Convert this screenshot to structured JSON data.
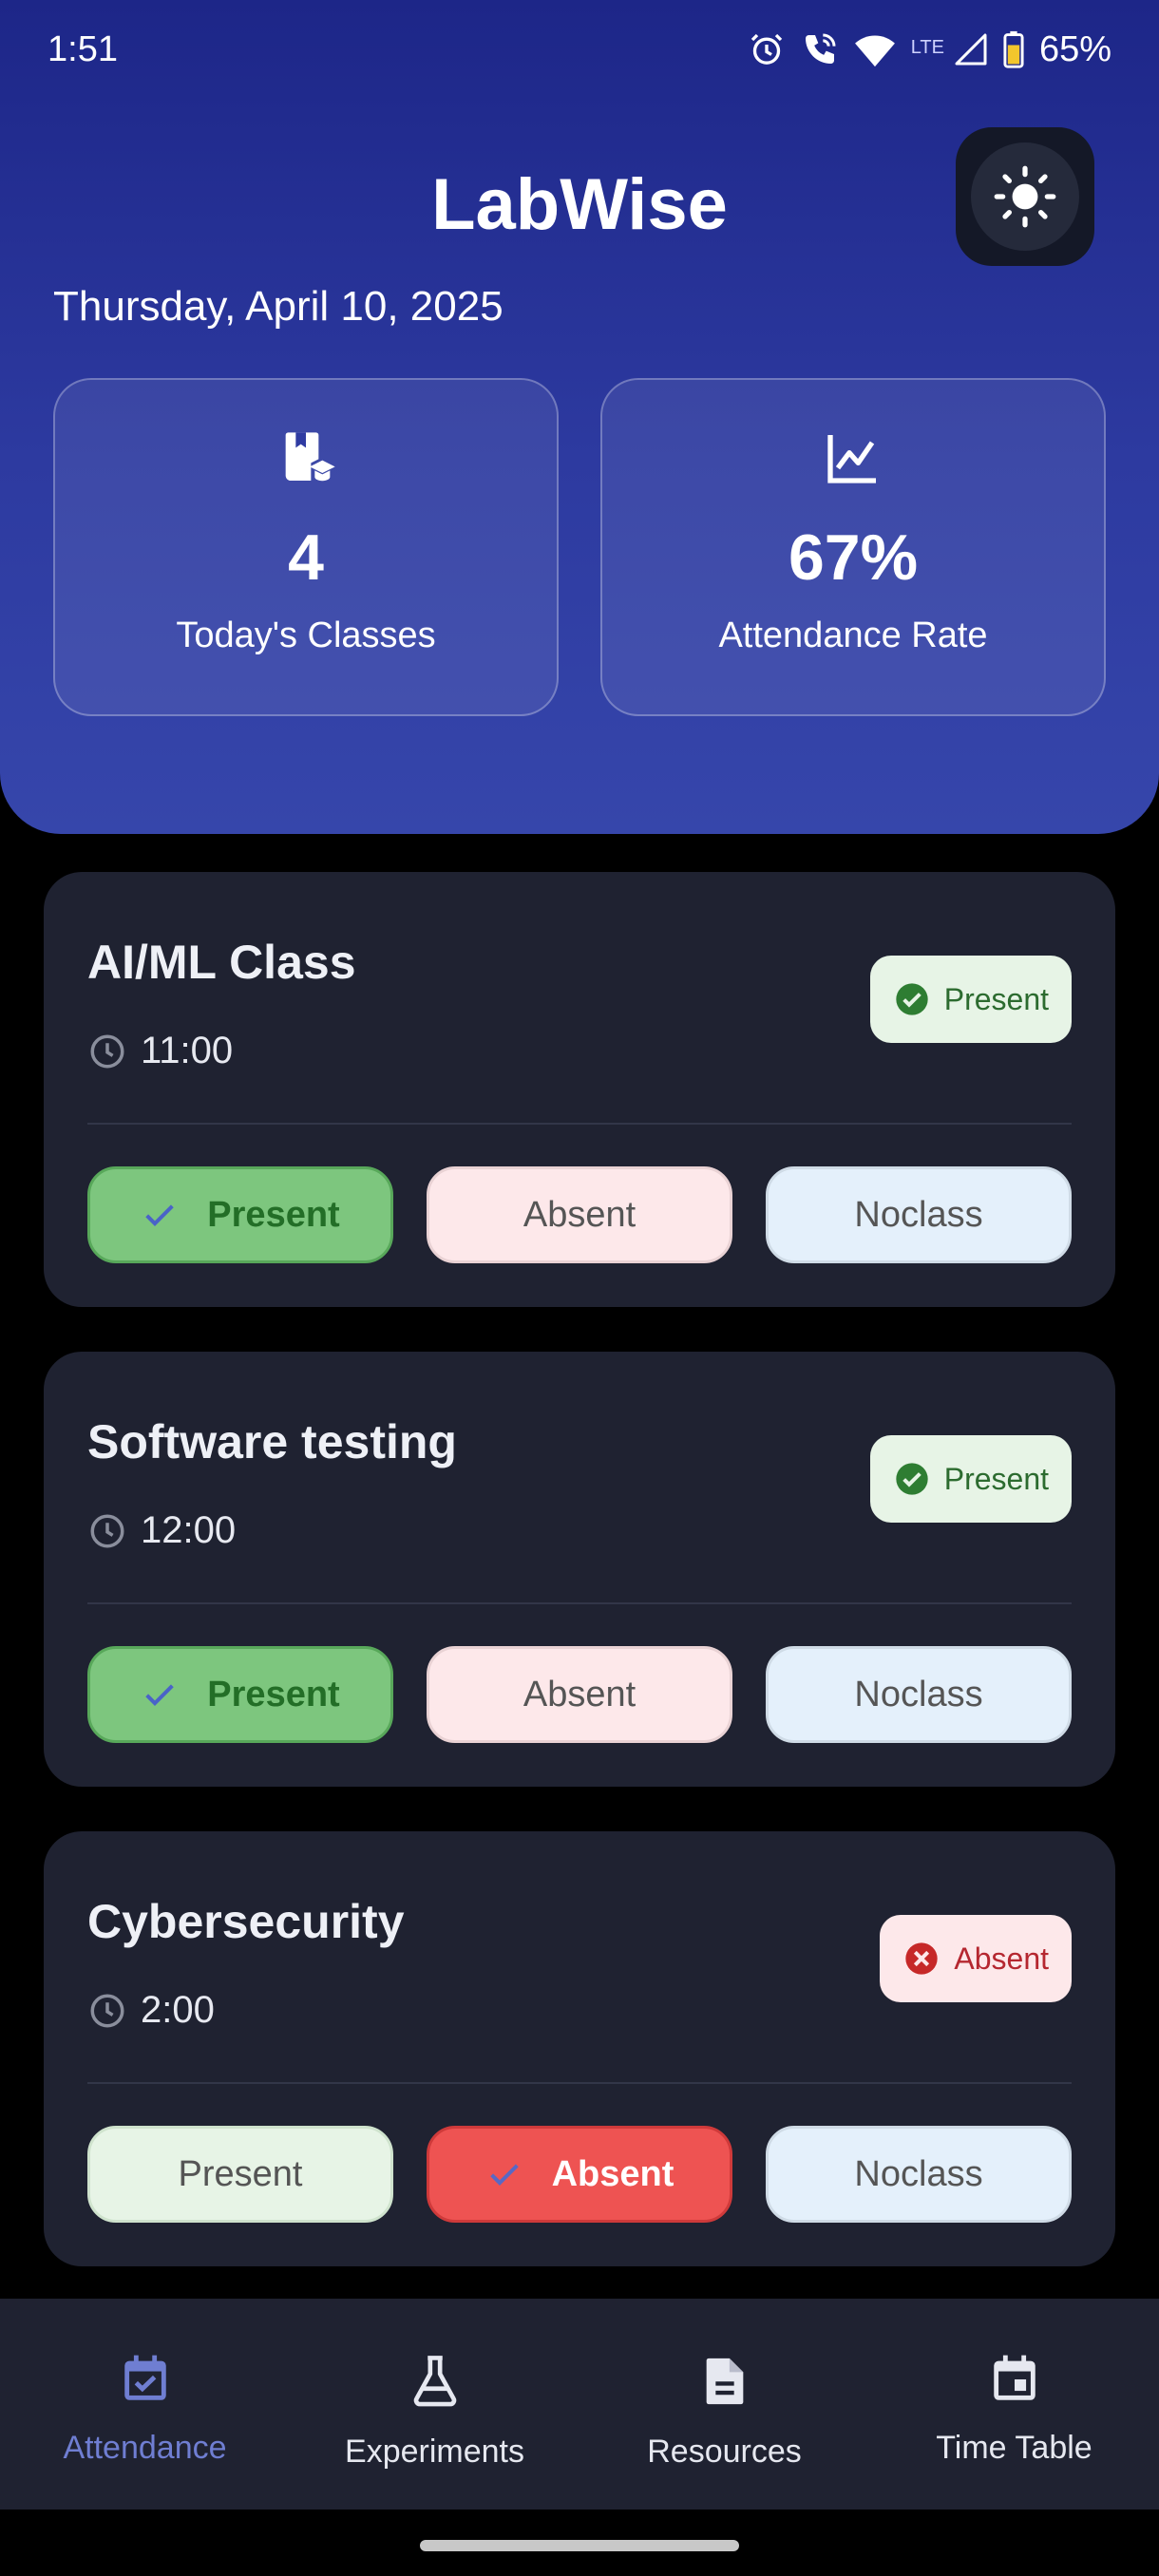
{
  "status_bar": {
    "time": "1:51",
    "battery": "65%",
    "network": "LTE"
  },
  "header": {
    "title": "LabWise",
    "date": "Thursday, April 10, 2025",
    "theme_icon": "sun-icon"
  },
  "stats": [
    {
      "value": "4",
      "label": "Today's Classes",
      "icon": "book-classes-icon"
    },
    {
      "value": "67%",
      "label": "Attendance Rate",
      "icon": "trending-chart-icon"
    }
  ],
  "classes": [
    {
      "name": "AI/ML Class",
      "time": "11:00",
      "status": "Present",
      "selected": "present"
    },
    {
      "name": "Software testing",
      "time": "12:00",
      "status": "Present",
      "selected": "present"
    },
    {
      "name": "Cybersecurity",
      "time": "2:00",
      "status": "Absent",
      "selected": "absent"
    }
  ],
  "options": {
    "present": "Present",
    "absent": "Absent",
    "noclass": "Noclass"
  },
  "nav": [
    {
      "label": "Attendance",
      "icon": "calendar-check-icon",
      "active": true
    },
    {
      "label": "Experiments",
      "icon": "flask-icon",
      "active": false
    },
    {
      "label": "Resources",
      "icon": "document-icon",
      "active": false
    },
    {
      "label": "Time Table",
      "icon": "calendar-icon",
      "active": false
    }
  ],
  "colors": {
    "header_top": "#1d2688",
    "header_bottom": "#3646ab",
    "card_bg": "#1f2231",
    "present_selected": "#7dc67e",
    "absent_selected": "#ee5352",
    "nav_active": "#6f7ed2"
  }
}
